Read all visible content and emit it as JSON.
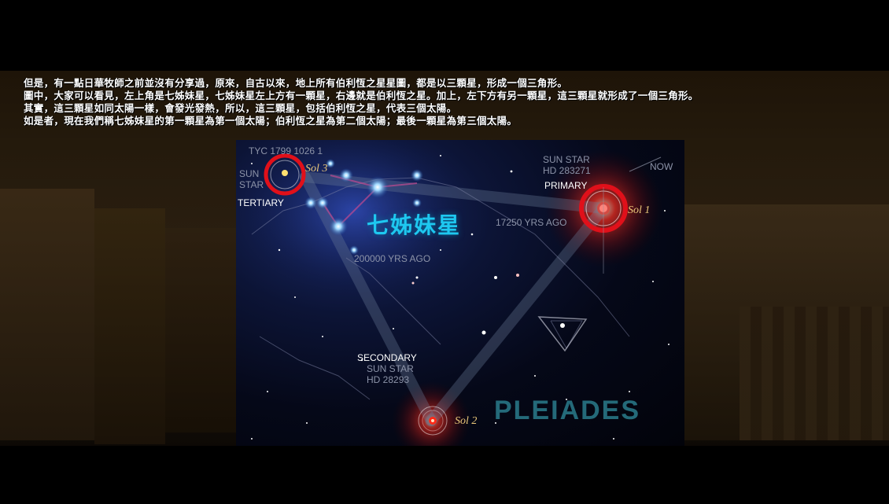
{
  "caption": {
    "line1": "但是，有一點日華牧師之前並沒有分享過，原來，自古以來，地上所有伯利恆之星星圖，都是以三顆星，形成一個三角形。",
    "line2": "圖中，大家可以看見，左上角是七姊妹星，七姊妹星左上方有一顆星，右邊就是伯利恆之星。加上，左下方有另一顆星，這三顆星就形成了一個三角形。",
    "line3": "其實，這三顆星如同太陽一樣，會發光發熱，所以，這三顆星，包括伯利恆之星，代表三個太陽。",
    "line4": "如是者，現在我們稱七姊妹星的第一顆星為第一個太陽；伯利恆之星為第二個太陽；最後一顆星為第三個太陽。"
  },
  "chart": {
    "tyc_label": "TYC 1799 1026 1",
    "sun_star_tertiary_1": "SUN",
    "sun_star_tertiary_2": "STAR",
    "tertiary": "TERTIARY",
    "sol3": "Sol 3",
    "seven_sisters": "七姊妹星",
    "sun_star_primary": "SUN STAR",
    "hd_primary": "HD 283271",
    "now": "NOW",
    "primary": "PRIMARY",
    "sol1": "Sol 1",
    "yrs_17250": "17250 YRS AGO",
    "yrs_200000": "200000 YRS AGO",
    "secondary": "SECONDARY",
    "sun_star_secondary": "SUN STAR",
    "hd_secondary": "HD 28293",
    "sol2": "Sol 2",
    "pleiades": "PLEIADES"
  },
  "colors": {
    "ring_red": "#e0101a",
    "cyan_label": "#1ec8f0",
    "star_blue": "#8fd0ff"
  }
}
